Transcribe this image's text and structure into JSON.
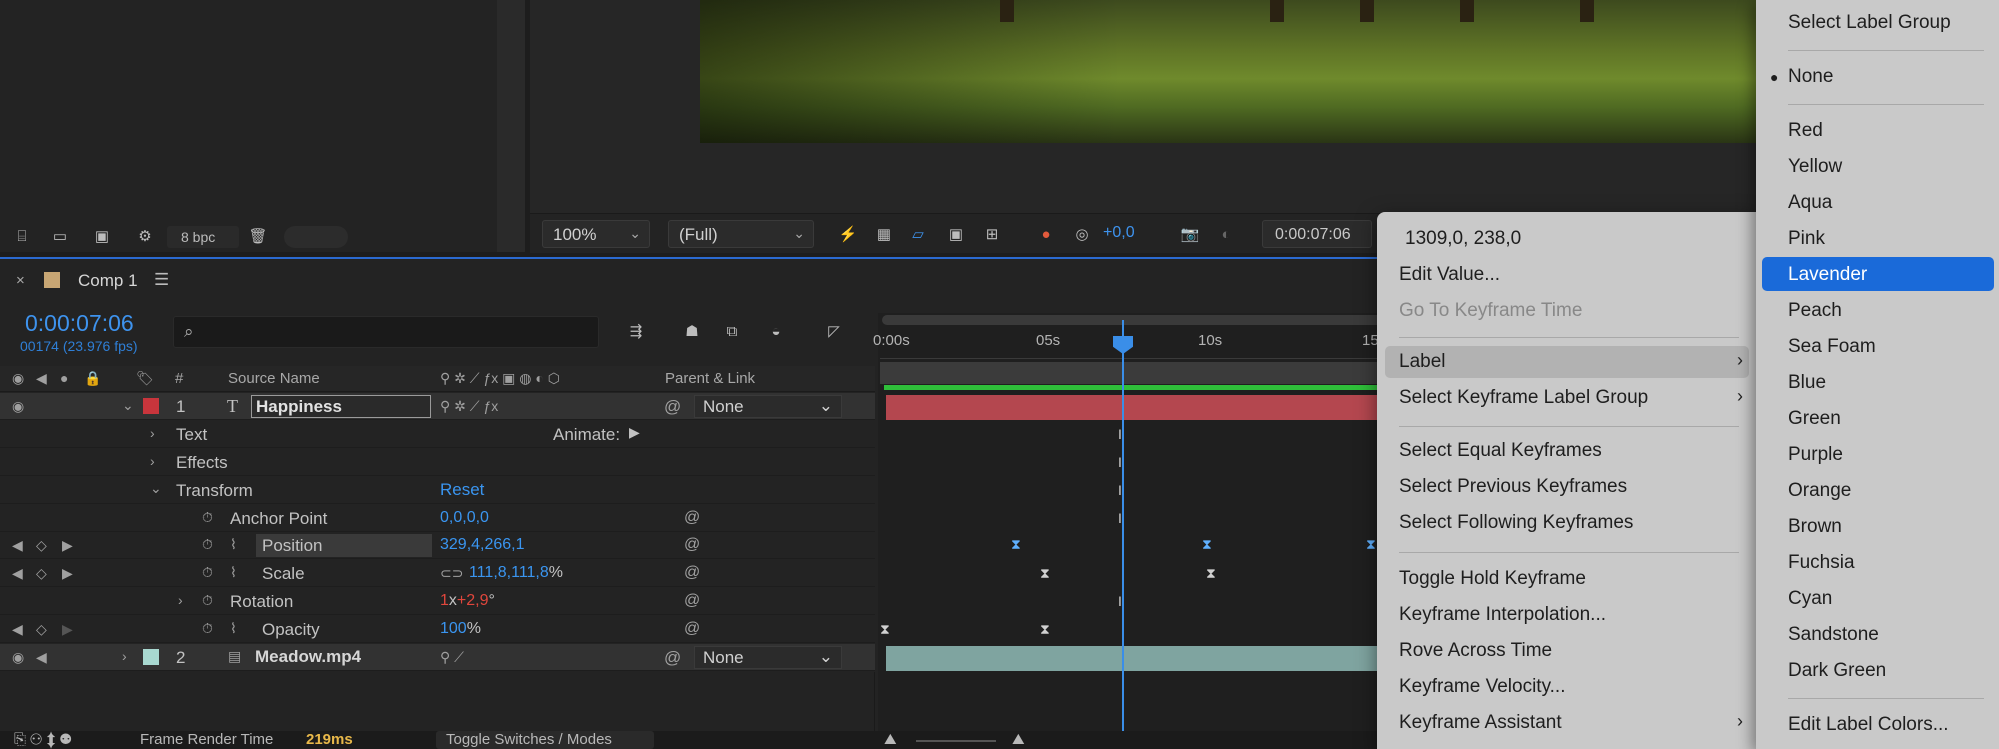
{
  "project": {
    "bpc": "8 bpc"
  },
  "viewer": {
    "zoom": "100%",
    "resolution": "(Full)",
    "exposure": "+0,0",
    "timecode": "0:00:07:06"
  },
  "comp": {
    "tab_name": "Comp 1",
    "timecode": "0:00:07:06",
    "fps": "00174 (23.976 fps)",
    "columns": {
      "num": "#",
      "source_name": "Source Name",
      "parent": "Parent & Link"
    },
    "layers": [
      {
        "num": "1",
        "name": "Happiness",
        "parent": "None",
        "color": "#c8353c"
      },
      {
        "num": "2",
        "name": "Meadow.mp4",
        "parent": "None",
        "color": "#a8d8d0"
      }
    ],
    "props": {
      "text": "Text",
      "animate": "Animate:",
      "effects": "Effects",
      "transform": "Transform",
      "reset": "Reset",
      "anchor_label": "Anchor Point",
      "anchor_value": "0,0,0,0",
      "position_label": "Position",
      "position_value": "329,4,266,1",
      "scale_label": "Scale",
      "scale_value": "111,8,111,8",
      "scale_unit": "%",
      "rotation_label": "Rotation",
      "rotation_turns": "1",
      "rotation_x": "x",
      "rotation_deg": "+2,9",
      "rotation_unit": "°",
      "opacity_label": "Opacity",
      "opacity_value": "100",
      "opacity_unit": "%"
    },
    "ruler": [
      "0:00s",
      "05s",
      "10s",
      "15"
    ],
    "status": {
      "render_label": "Frame Render Time",
      "render_value": "219ms",
      "toggle": "Toggle Switches / Modes"
    }
  },
  "context_menu": {
    "value_readout": "1309,0, 238,0",
    "edit_value": "Edit Value...",
    "go_to_keyframe": "Go To Keyframe Time",
    "label": "Label",
    "select_label_group": "Select Keyframe Label Group",
    "select_equal": "Select Equal Keyframes",
    "select_previous": "Select Previous Keyframes",
    "select_following": "Select Following Keyframes",
    "toggle_hold": "Toggle Hold Keyframe",
    "interpolation": "Keyframe Interpolation...",
    "rove": "Rove Across Time",
    "velocity": "Keyframe Velocity...",
    "assistant": "Keyframe Assistant"
  },
  "label_submenu": {
    "select_group": "Select Label Group",
    "none": "None",
    "colors": [
      "Red",
      "Yellow",
      "Aqua",
      "Pink",
      "Lavender",
      "Peach",
      "Sea Foam",
      "Blue",
      "Green",
      "Purple",
      "Orange",
      "Brown",
      "Fuchsia",
      "Cyan",
      "Sandstone",
      "Dark Green"
    ],
    "selected": "Lavender",
    "edit_colors": "Edit Label Colors..."
  }
}
